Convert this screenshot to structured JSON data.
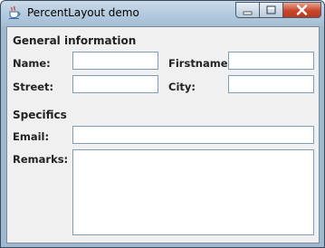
{
  "window": {
    "title": "PercentLayout demo"
  },
  "form": {
    "general_heading": "General information",
    "name_label": "Name:",
    "name_value": "",
    "firstname_label": "Firstname:",
    "firstname_value": "",
    "street_label": "Street:",
    "street_value": "",
    "city_label": "City:",
    "city_value": "",
    "specifics_heading": "Specifics",
    "email_label": "Email:",
    "email_value": "",
    "remarks_label": "Remarks:",
    "remarks_value": ""
  },
  "icons": {
    "app": "java-cup-icon",
    "minimize": "minimize-icon",
    "maximize": "maximize-icon",
    "close": "close-icon"
  }
}
